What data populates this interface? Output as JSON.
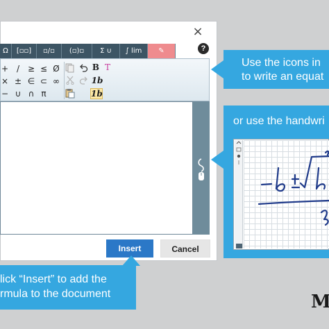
{
  "dialog": {
    "close_symbol": "×",
    "help_symbol": "?",
    "tabs": [
      {
        "label": "Ω",
        "icon": "greek-letters-icon"
      },
      {
        "label": "[▫▫]",
        "icon": "matrix-icon"
      },
      {
        "label": "▫/▫",
        "icon": "fraction-icon"
      },
      {
        "label": "(▫)▫",
        "icon": "brackets-icon"
      },
      {
        "label": "Σ ∪",
        "icon": "sum-union-icon"
      },
      {
        "label": "∫ lim",
        "icon": "integral-limit-icon"
      },
      {
        "label": "✎",
        "icon": "handwriting-icon"
      }
    ],
    "toolbar": {
      "row1": [
        "+",
        "/",
        "≥",
        "≤",
        "Ø"
      ],
      "row2": [
        "×",
        "±",
        "∈",
        "⊂",
        "∞"
      ],
      "row3": [
        "−",
        "∪",
        "∩",
        "π"
      ],
      "actions": {
        "copy_icon": "copy-icon",
        "undo_icon": "undo-icon",
        "redo_icon": "redo-icon",
        "cut_icon": "cut-icon",
        "paste_icon": "paste-icon",
        "bold": "B",
        "text_style": "T",
        "italic_b": "1b",
        "italic_b_highlight": "1b"
      }
    },
    "buttons": {
      "insert": "Insert",
      "cancel": "Cancel"
    }
  },
  "callouts": {
    "top_lines": [
      "Use the icons in",
      "to write an equat"
    ],
    "right_caption": "or use the handwri",
    "bottom_lines": [
      "lick “Insert” to add the",
      "rmula to the document"
    ]
  },
  "logo": "M",
  "colors": {
    "tab_bg": "#3d5564",
    "handwrite_tab": "#ef8b8e",
    "callout": "#35a7e0",
    "insert_button": "#2b78c7"
  }
}
